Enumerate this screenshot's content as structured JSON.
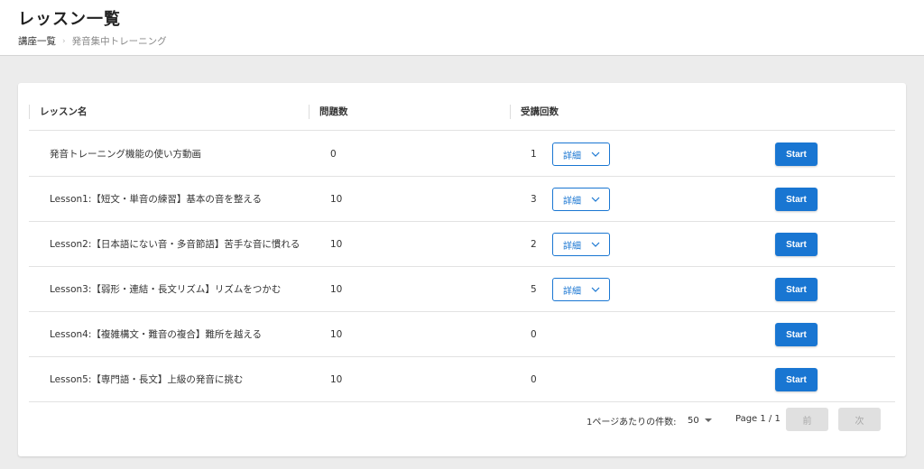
{
  "header": {
    "title": "レッスン一覧",
    "breadcrumb": {
      "parent": "講座一覧",
      "separator": "›",
      "current": "発音集中トレーニング"
    }
  },
  "table": {
    "columns": [
      "レッスン名",
      "問題数",
      "受講回数"
    ],
    "detail_label": "詳細",
    "start_label": "Start",
    "rows": [
      {
        "name": "発音トレーニング機能の使い方動画",
        "count": "0",
        "times": "1",
        "has_detail": true
      },
      {
        "name": "Lesson1:【短文・単音の練習】基本の音を整える",
        "count": "10",
        "times": "3",
        "has_detail": true
      },
      {
        "name": "Lesson2:【日本語にない音・多音節語】苦手な音に慣れる",
        "count": "10",
        "times": "2",
        "has_detail": true
      },
      {
        "name": "Lesson3:【弱形・連結・長文リズム】リズムをつかむ",
        "count": "10",
        "times": "5",
        "has_detail": true
      },
      {
        "name": "Lesson4:【複雑構文・難音の複合】難所を越える",
        "count": "10",
        "times": "0",
        "has_detail": false
      },
      {
        "name": "Lesson5:【専門語・長文】上級の発音に挑む",
        "count": "10",
        "times": "0",
        "has_detail": false
      }
    ]
  },
  "pagination": {
    "per_page_label": "1ページあたりの件数:",
    "per_page_value": "50",
    "page_info": "Page 1 / 1",
    "prev_label": "前",
    "next_label": "次"
  },
  "colors": {
    "accent": "#1976d2",
    "background": "#ececec",
    "disabled": "#e0e0e0"
  },
  "icons": {
    "detail_dropdown": "chevron-down-icon",
    "per_page_dropdown": "caret-down-icon"
  }
}
